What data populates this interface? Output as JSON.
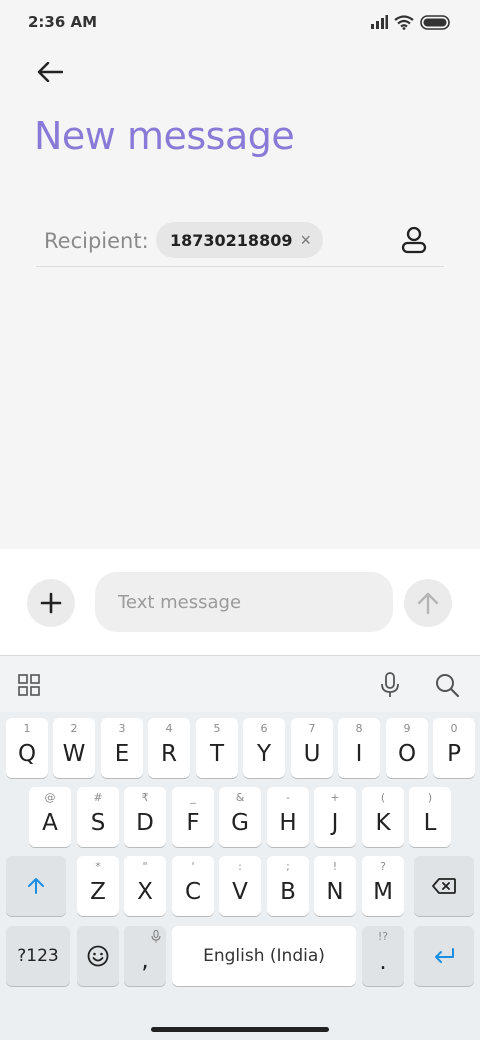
{
  "status_bar": {
    "time": "2:36 AM",
    "icons": [
      "signal-icon",
      "wifi-icon",
      "battery-icon"
    ]
  },
  "header": {
    "back_icon": "arrow-left-icon",
    "title": "New message"
  },
  "recipient": {
    "label": "Recipient:",
    "chip_value": "18730218809",
    "chip_remove": "×",
    "contact_icon": "person-icon"
  },
  "composer": {
    "add_icon": "plus-icon",
    "placeholder": "Text message",
    "value": "",
    "send_icon": "arrow-up-icon"
  },
  "keyboard": {
    "toolbar_icons": [
      "apps-grid-icon",
      "microphone-icon",
      "search-icon"
    ],
    "row1": [
      {
        "key": "Q",
        "hint": "1"
      },
      {
        "key": "W",
        "hint": "2"
      },
      {
        "key": "E",
        "hint": "3"
      },
      {
        "key": "R",
        "hint": "4"
      },
      {
        "key": "T",
        "hint": "5"
      },
      {
        "key": "Y",
        "hint": "6"
      },
      {
        "key": "U",
        "hint": "7"
      },
      {
        "key": "I",
        "hint": "8"
      },
      {
        "key": "O",
        "hint": "9"
      },
      {
        "key": "P",
        "hint": "0"
      }
    ],
    "row2": [
      {
        "key": "A",
        "hint": "@"
      },
      {
        "key": "S",
        "hint": "#"
      },
      {
        "key": "D",
        "hint": "₹"
      },
      {
        "key": "F",
        "hint": "_"
      },
      {
        "key": "G",
        "hint": "&"
      },
      {
        "key": "H",
        "hint": "-"
      },
      {
        "key": "J",
        "hint": "+"
      },
      {
        "key": "K",
        "hint": "("
      },
      {
        "key": "L",
        "hint": ")"
      }
    ],
    "row3": [
      {
        "key": "Z",
        "hint": "*"
      },
      {
        "key": "X",
        "hint": "\""
      },
      {
        "key": "C",
        "hint": "'"
      },
      {
        "key": "V",
        "hint": ":"
      },
      {
        "key": "B",
        "hint": ";"
      },
      {
        "key": "N",
        "hint": "!"
      },
      {
        "key": "M",
        "hint": "?"
      }
    ],
    "shift_icon": "shift-arrow-icon",
    "backspace_icon": "backspace-icon",
    "symbols_key": "?123",
    "emoji_icon": "emoji-icon",
    "comma_key": ",",
    "space_label": "English (India)",
    "period_key": ".",
    "period_hint": "!?",
    "enter_icon": "enter-icon",
    "accent_color": "#1a8fe3"
  }
}
